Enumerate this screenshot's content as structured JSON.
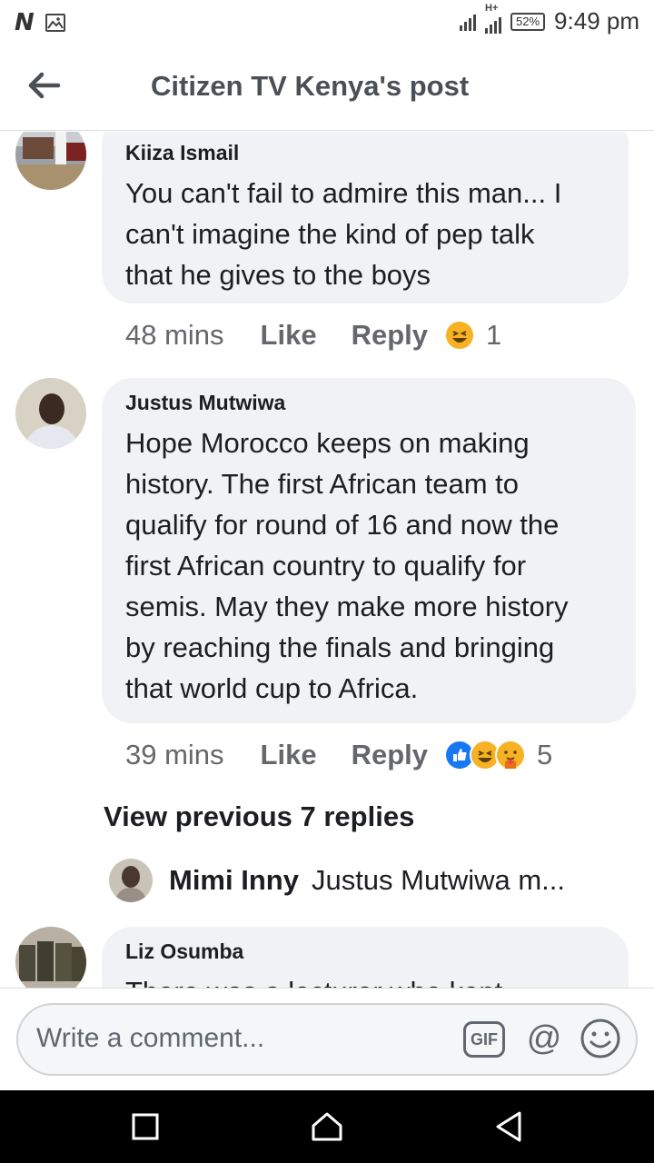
{
  "status_bar": {
    "left_icons": [
      "n-app-icon",
      "image-icon"
    ],
    "network_label": "H+",
    "battery": "52%",
    "time": "9:49 pm"
  },
  "header": {
    "title": "Citizen TV Kenya's post",
    "back_icon": "arrow-left-icon"
  },
  "comments": [
    {
      "author": "Kiiza Ismail",
      "text": "You can't fail to admire this man... I can't imagine the kind of pep talk that he gives to the boys",
      "lines": [
        "You can't fail to admire this man... I",
        "can't imagine the kind of pep talk",
        "that he gives to the boys"
      ],
      "time": "48 mins",
      "like": "Like",
      "reply": "Reply",
      "reactions": [
        "haha"
      ],
      "reaction_count": "1"
    },
    {
      "author": "Justus Mutwiwa",
      "text": "Hope Morocco keeps on making history. The first African  team to qualify for round of 16 and now the first African country to qualify for semis. May they make more history by reaching the finals and bringing that world cup to Africa.",
      "lines": [
        "Hope Morocco keeps on making",
        "history. The first African  team to",
        "qualify for round of 16 and now the",
        "first African country to qualify for",
        "semis. May they make more history",
        "by reaching the finals and bringing",
        "that world cup to Africa."
      ],
      "time": "39 mins",
      "like": "Like",
      "reply": "Reply",
      "reactions": [
        "like",
        "haha",
        "care"
      ],
      "reaction_count": "5"
    },
    {
      "author": "Liz Osumba",
      "partial_line": "There was a lecturer who kept"
    }
  ],
  "view_previous": "View previous 7 replies",
  "reply_preview": {
    "author": "Mimi Inny",
    "text": "Justus Mutwiwa m..."
  },
  "composer": {
    "placeholder": "Write a comment...",
    "gif_label": "GIF",
    "at_label": "@",
    "emoji_icon": "smiley-icon"
  },
  "nav": [
    "recents-square-icon",
    "home-icon",
    "back-triangle-icon"
  ],
  "colors": {
    "bubble": "#f0f2f5",
    "meta_text": "#65676b",
    "like_blue": "#1877f2",
    "haha_yellow": "#f7b125"
  }
}
